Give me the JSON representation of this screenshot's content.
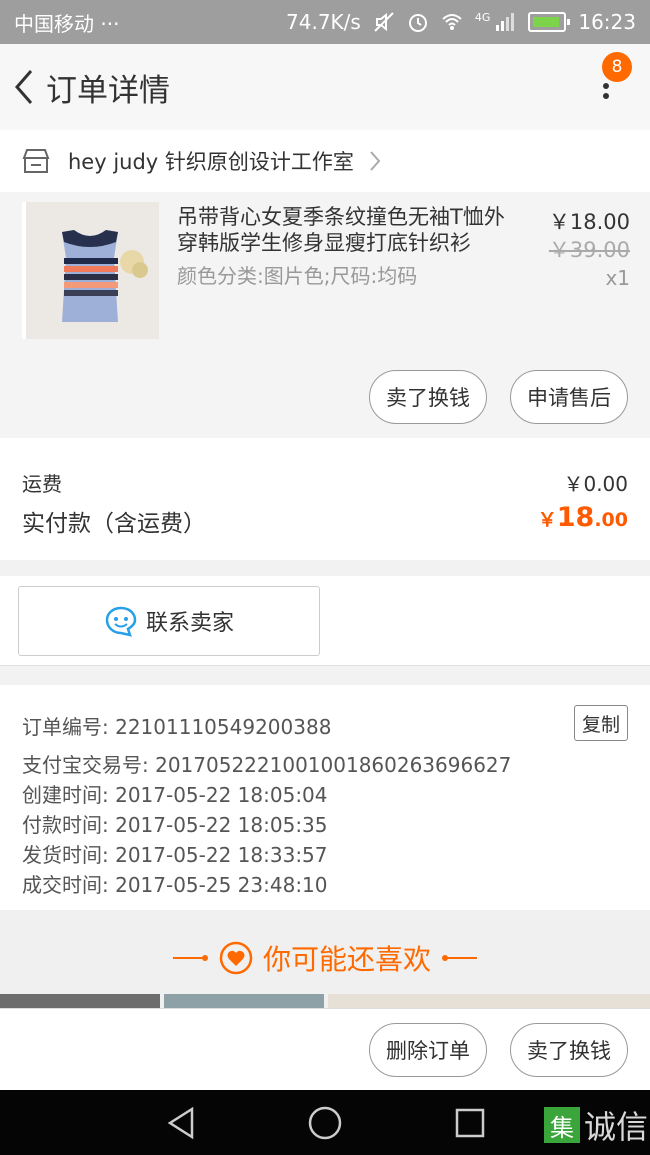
{
  "status_bar": {
    "carrier": "中国移动 ···",
    "speed": "74.7K/s",
    "network": "4G",
    "time": "16:23"
  },
  "nav": {
    "title": "订单详情",
    "badge": "8"
  },
  "shop": {
    "name": "hey judy 针织原创设计工作室"
  },
  "item": {
    "title": "吊带背心女夏季条纹撞色无袖T恤外穿韩版学生修身显瘦打底针织衫",
    "spec": "颜色分类:图片色;尺码:均码",
    "price": "￥18.00",
    "original_price": "￥39.00",
    "quantity": "x1",
    "actions": {
      "sell": "卖了换钱",
      "after_sale": "申请售后"
    }
  },
  "fees": {
    "shipping_label": "运费",
    "shipping_value": "￥0.00",
    "paid_label": "实付款（含运费）",
    "paid_currency": "￥",
    "paid_int": "18",
    "paid_dec": ".00"
  },
  "contact": {
    "label": "联系卖家"
  },
  "order_info": {
    "order_no": "订单编号: 22101110549200388",
    "alipay_no": "支付宝交易号: 2017052221001001860263696627",
    "created": "创建时间: 2017-05-22 18:05:04",
    "paid": "付款时间: 2017-05-22 18:05:35",
    "shipped": "发货时间: 2017-05-22 18:33:57",
    "completed": "成交时间: 2017-05-25 23:48:10",
    "copy_label": "复制"
  },
  "recommend": {
    "title": "你可能还喜欢"
  },
  "bottom_bar": {
    "delete": "删除订单",
    "sell": "卖了换钱"
  },
  "watermark": {
    "text": "诚信",
    "logo_char": "集"
  },
  "colors": {
    "accent": "#ff5a00",
    "badge": "#ff6a00",
    "status_bar": "#9e9e9e"
  }
}
